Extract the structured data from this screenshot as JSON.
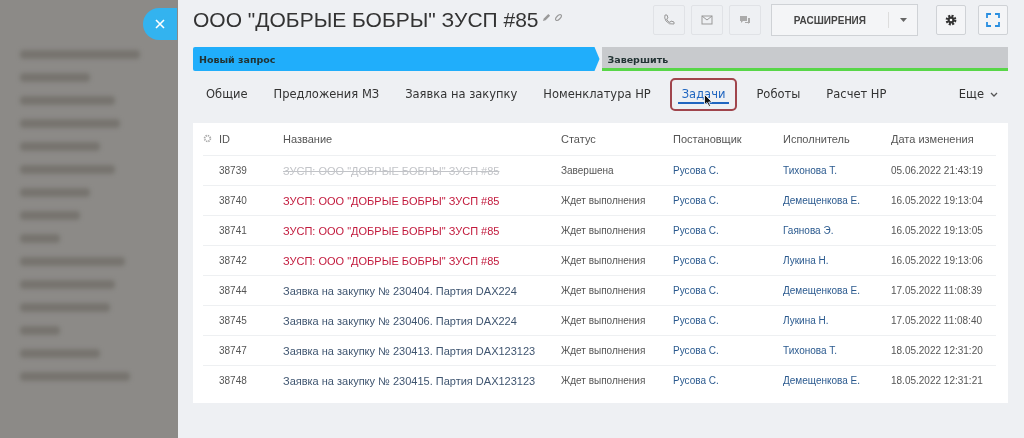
{
  "header": {
    "title": "ООО \"ДОБРЫЕ БОБРЫ\" ЗУСП #85",
    "extensions_button": "РАСШИРЕНИЯ"
  },
  "stages": [
    {
      "label": "Новый запрос",
      "active": true
    },
    {
      "label": "Завершить",
      "active": false
    }
  ],
  "tabs": [
    {
      "label": "Общие",
      "selected": false
    },
    {
      "label": "Предложения МЗ",
      "selected": false
    },
    {
      "label": "Заявка на закупку",
      "selected": false
    },
    {
      "label": "Номенклатура НР",
      "selected": false
    },
    {
      "label": "Задачи",
      "selected": true
    },
    {
      "label": "Роботы",
      "selected": false
    },
    {
      "label": "Расчет НР",
      "selected": false
    }
  ],
  "more_tab": "Еще",
  "table": {
    "columns": [
      "ID",
      "Название",
      "Статус",
      "Постановщик",
      "Исполнитель",
      "Дата изменения"
    ],
    "rows": [
      {
        "kind": "completed",
        "cells": [
          "38739",
          "ЗУСП: ООО \"ДОБРЫЕ БОБРЫ\" ЗУСП #85",
          "Завершена",
          "Русова С.",
          "Тихонова Т.",
          "05.06.2022 21:43:19"
        ]
      },
      {
        "kind": "overdue",
        "cells": [
          "38740",
          "ЗУСП: ООО \"ДОБРЫЕ БОБРЫ\" ЗУСП #85",
          "Ждет выполнения",
          "Русова С.",
          "Демещенкова Е.",
          "16.05.2022 19:13:04"
        ]
      },
      {
        "kind": "overdue",
        "cells": [
          "38741",
          "ЗУСП: ООО \"ДОБРЫЕ БОБРЫ\" ЗУСП #85",
          "Ждет выполнения",
          "Русова С.",
          "Гаянова Э.",
          "16.05.2022 19:13:05"
        ]
      },
      {
        "kind": "overdue",
        "cells": [
          "38742",
          "ЗУСП: ООО \"ДОБРЫЕ БОБРЫ\" ЗУСП #85",
          "Ждет выполнения",
          "Русова С.",
          "Лукина Н.",
          "16.05.2022 19:13:06"
        ]
      },
      {
        "kind": "normal",
        "cells": [
          "38744",
          "Заявка на закупку № 230404. Партия DAX224",
          "Ждет выполнения",
          "Русова С.",
          "Демещенкова Е.",
          "17.05.2022 11:08:39"
        ]
      },
      {
        "kind": "normal",
        "cells": [
          "38745",
          "Заявка на закупку № 230406. Партия DAX224",
          "Ждет выполнения",
          "Русова С.",
          "Лукина Н.",
          "17.05.2022 11:08:40"
        ]
      },
      {
        "kind": "normal",
        "cells": [
          "38747",
          "Заявка на закупку № 230413. Партия DAX123123",
          "Ждет выполнения",
          "Русова С.",
          "Тихонова Т.",
          "18.05.2022 12:31:20"
        ]
      },
      {
        "kind": "normal",
        "cells": [
          "38748",
          "Заявка на закупку № 230415. Партия DAX123123",
          "Ждет выполнения",
          "Русова С.",
          "Демещенкова Е.",
          "18.05.2022 12:31:21"
        ]
      }
    ]
  }
}
